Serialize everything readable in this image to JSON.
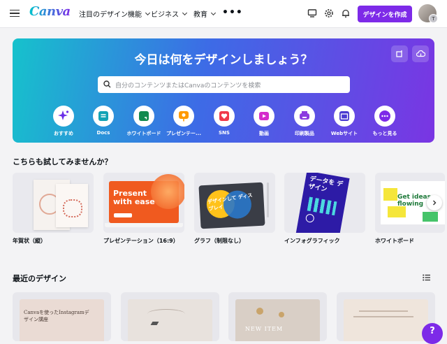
{
  "topbar": {
    "logo": "Canva",
    "nav": [
      {
        "label": "注目のデザイン機能"
      },
      {
        "label": "ビジネス"
      },
      {
        "label": "教育"
      }
    ],
    "more": "•••",
    "create_button": "デザインを作成",
    "avatar_badge": "T"
  },
  "hero": {
    "title": "今日は何をデザインしましょう？",
    "search_placeholder": "自分のコンテンツまたはCanvaのコンテンツを検索",
    "categories": [
      {
        "label": "おすすめ",
        "icon": "sparkle-icon",
        "color": "#6b2ee8"
      },
      {
        "label": "Docs",
        "icon": "docs-icon",
        "color": "#13a3b5"
      },
      {
        "label": "ホワイトボード",
        "icon": "whiteboard-icon",
        "color": "#138a4f"
      },
      {
        "label": "プレゼンテー...",
        "icon": "presentation-icon",
        "color": "#ff9a00"
      },
      {
        "label": "SNS",
        "icon": "heart-icon",
        "color": "#f0394a"
      },
      {
        "label": "動画",
        "icon": "video-icon",
        "color": "#d42dcb"
      },
      {
        "label": "印刷製品",
        "icon": "print-icon",
        "color": "#8c3ae0"
      },
      {
        "label": "Webサイト",
        "icon": "website-icon",
        "color": "#4a3bd1"
      },
      {
        "label": "もっと見る",
        "icon": "more-icon",
        "color": "#7d2ae8"
      }
    ]
  },
  "suggestions": {
    "title": "こちらも試してみませんか？",
    "cards": [
      {
        "label": "年賀状（縦）"
      },
      {
        "label": "プレゼンテーション（16:9）",
        "preview_text": "Present with ease"
      },
      {
        "label": "グラフ（制限なし）",
        "preview_text": "デザインして ディスプレイ"
      },
      {
        "label": "インフォグラフィック",
        "preview_text": "データを デザイン"
      },
      {
        "label": "ホワイトボード",
        "preview_text": "Get ideas flowing"
      }
    ]
  },
  "recent": {
    "title": "最近のデザイン",
    "items": [
      {
        "preview_text": "Canvaを使ったInstagramデザイン講座"
      },
      {
        "preview_text": ""
      },
      {
        "preview_text": "NEW ITEM"
      },
      {
        "preview_text": ""
      }
    ]
  },
  "help_button": "?"
}
